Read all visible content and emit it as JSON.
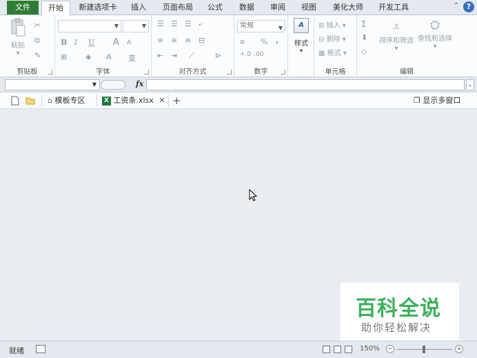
{
  "tabs": {
    "file": "文件",
    "items": [
      "开始",
      "新建选项卡",
      "插入",
      "页面布局",
      "公式",
      "数据",
      "审阅",
      "视图",
      "美化大师",
      "开发工具"
    ],
    "active": "开始"
  },
  "ribbon": {
    "clipboard": {
      "label": "剪贴板",
      "paste": "粘贴"
    },
    "font": {
      "label": "字体",
      "bold": "B",
      "italic": "I",
      "underline": "U",
      "grow": "A",
      "shrink": "A",
      "font_color": "A",
      "phonetic": "变"
    },
    "alignment": {
      "label": "对齐方式"
    },
    "number": {
      "label": "数字",
      "format": "常规",
      "percent": "%",
      "comma": ","
    },
    "styles": {
      "label": "样式"
    },
    "cells": {
      "label": "单元格",
      "insert": "插入",
      "delete": "删除",
      "format": "格式"
    },
    "editing": {
      "label": "编辑",
      "sort": "排序和筛选",
      "find": "查找和选择",
      "sum": "Σ"
    }
  },
  "formula_bar": {
    "fx": "fx",
    "name_value": "",
    "formula_value": ""
  },
  "doc_tabs": {
    "templates": "模板专区",
    "file": "工资条.xlsx",
    "close": "✕",
    "add": "+",
    "multi_window": "显示多窗口"
  },
  "status": {
    "ready": "就绪",
    "zoom": "150%"
  },
  "watermark": {
    "title": "百科全说",
    "subtitle": "助你轻松解决"
  },
  "colors": {
    "file_tab": "#2f7d32",
    "watermark": "#3cb05c",
    "help": "#3b6dbf"
  }
}
